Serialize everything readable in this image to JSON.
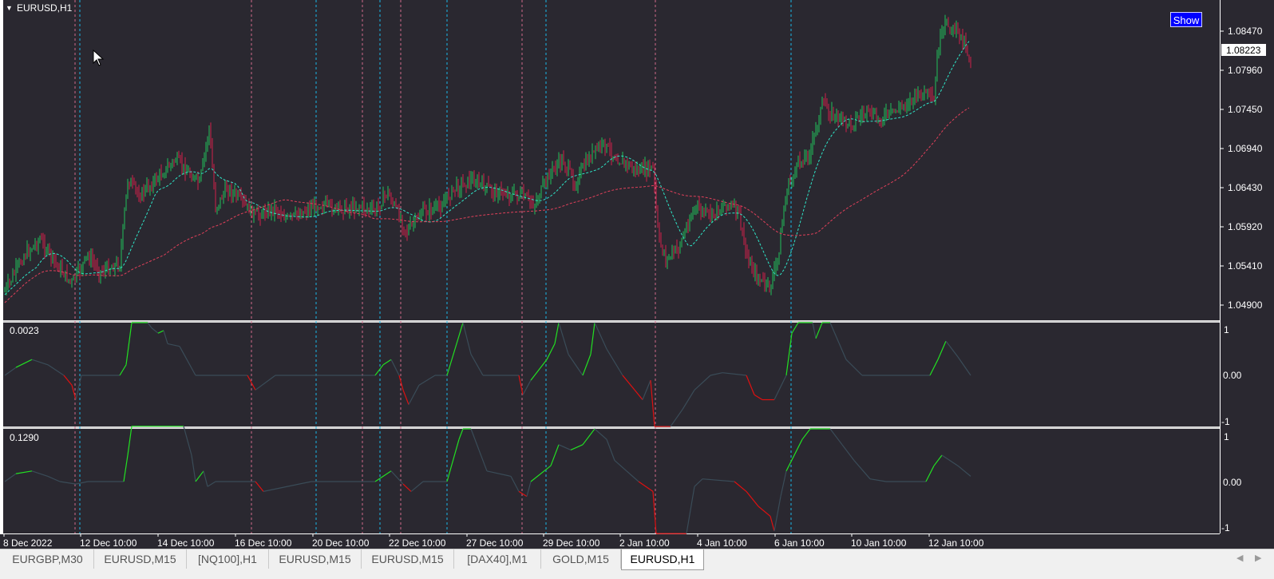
{
  "window": {
    "symbol_label": "EURUSD,H1",
    "show_button": "Show"
  },
  "price_panel": {
    "current_price": "1.08223",
    "price_labels": [
      "1.08470",
      "1.07960",
      "1.07450",
      "1.06940",
      "1.06430",
      "1.05920",
      "1.05410",
      "1.04900"
    ],
    "price_levels": [
      1.0847,
      1.0796,
      1.0745,
      1.0694,
      1.0643,
      1.0592,
      1.0541,
      1.049
    ],
    "ma_fast_color": "#2ee6c8",
    "ma_slow_color": "#e0405a",
    "bull_color": "#20c05a",
    "bear_color": "#d0204a"
  },
  "indicator_1": {
    "value_label": "0.0023",
    "scale_labels": [
      "1",
      "0.00",
      "-1"
    ]
  },
  "indicator_2": {
    "value_label": "0.1290",
    "scale_labels": [
      "1",
      "0.00",
      "-1"
    ]
  },
  "time_axis": {
    "labels": [
      "8 Dec 2022",
      "12 Dec 10:00",
      "14 Dec 10:00",
      "16 Dec 10:00",
      "20 Dec 10:00",
      "22 Dec 10:00",
      "27 Dec 10:00",
      "29 Dec 10:00",
      "2 Jan 10:00",
      "4 Jan 10:00",
      "6 Jan 10:00",
      "10 Jan 10:00",
      "12 Jan 10:00"
    ]
  },
  "colors": {
    "chart_bg": "#2a2830",
    "axis_text": "#ffffff",
    "pink_marker": "#d06a8a",
    "cyan_marker": "#1ab8e8",
    "osc_neutral": "#3a4c58",
    "osc_up": "#22e022",
    "osc_down": "#e01010"
  },
  "tabs": [
    {
      "label": "EURGBP,M30",
      "active": false
    },
    {
      "label": "EURUSD,M15",
      "active": false
    },
    {
      "label": "[NQ100],H1",
      "active": false
    },
    {
      "label": "EURUSD,M15",
      "active": false
    },
    {
      "label": "EURUSD,M15",
      "active": false
    },
    {
      "label": "[DAX40],M1",
      "active": false
    },
    {
      "label": "GOLD,M15",
      "active": false
    },
    {
      "label": "EURUSD,H1",
      "active": true
    }
  ]
}
